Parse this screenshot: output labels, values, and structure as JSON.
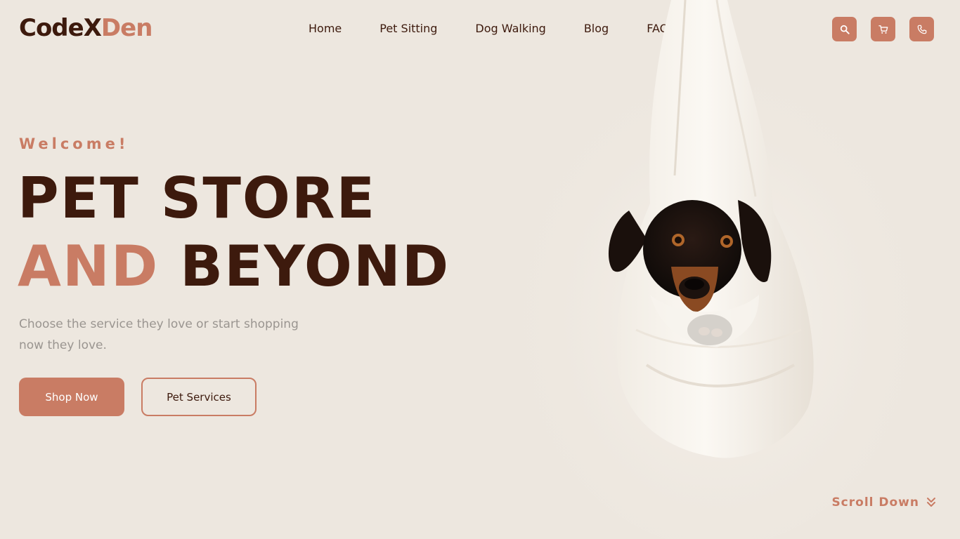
{
  "brand": {
    "part1": "CodeX",
    "part2": "Den"
  },
  "nav": [
    {
      "label": "Home"
    },
    {
      "label": "Pet Sitting"
    },
    {
      "label": "Dog Walking"
    },
    {
      "label": "Blog"
    },
    {
      "label": "FAQ"
    }
  ],
  "header_actions": [
    {
      "icon": "search-icon"
    },
    {
      "icon": "cart-icon"
    },
    {
      "icon": "phone-icon"
    }
  ],
  "hero": {
    "welcome": "Welcome!",
    "line1": "PET STORE",
    "line2_accent": "AND",
    "line2_rest": "BEYOND",
    "subtitle": "Choose the service they love or start shopping now they love.",
    "primary_button": "Shop Now",
    "secondary_button": "Pet Services"
  },
  "scroll": {
    "label": "Scroll Down",
    "icon": "double-chevron-down-icon"
  },
  "colors": {
    "background": "#ede7df",
    "accent": "#c97c64",
    "dark": "#3d1a0d",
    "muted": "#9a9590"
  }
}
